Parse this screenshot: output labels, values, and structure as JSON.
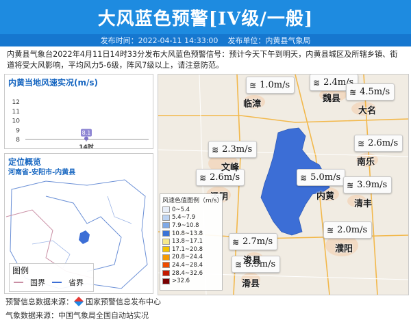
{
  "header": {
    "title": "大风蓝色预警[IV级/一般]",
    "publish_time": "发布时间：2022-04-11 14:33:00",
    "publish_unit": "发布单位：内黄县气象局"
  },
  "description": "内黄县气象台2022年4月11日14时33分发布大风蓝色预警信号：预计今天下午到明天，内黄县城区及所辖乡镇、街道将受大风影响，平均风力5-6级，阵风7级以上，请注意防范。",
  "wind_panel": {
    "title": "内黄当地风速实况(m/s)",
    "chart_data": {
      "type": "scatter",
      "categories": [
        "14时"
      ],
      "values": [
        8.1
      ],
      "ylim": [
        8,
        12
      ],
      "yticks": [
        "12",
        "11",
        "10",
        "9",
        "8"
      ],
      "value_label": "8.1"
    }
  },
  "location_panel": {
    "title": "定位概览",
    "path": "河南省-安阳市-内黄县",
    "legend_title": "图例",
    "legend_items": [
      "国界",
      "省界"
    ]
  },
  "map": {
    "badges": [
      {
        "value": "1.0m/s"
      },
      {
        "value": "2.4m/s"
      },
      {
        "value": "4.5m/s"
      },
      {
        "value": "2.6m/s"
      },
      {
        "value": "2.3m/s"
      },
      {
        "value": "2.6m/s"
      },
      {
        "value": "5.0m/s"
      },
      {
        "value": "3.9m/s"
      },
      {
        "value": "2.0m/s"
      },
      {
        "value": "2.7m/s"
      },
      {
        "value": "3.5m/s"
      }
    ],
    "cities": [
      "临漳",
      "魏县",
      "大名",
      "南乐",
      "文峰",
      "汤阴",
      "内黄",
      "清丰",
      "濮阳",
      "浚县",
      "滑县"
    ],
    "wind_legend": {
      "title": "风速色值图例（m/s）",
      "items": [
        {
          "label": "0~5.4",
          "color": "#e8eef8"
        },
        {
          "label": "5.4~7.9",
          "color": "#bcd3f2"
        },
        {
          "label": "7.9~10.8",
          "color": "#7fa9e6"
        },
        {
          "label": "10.8~13.8",
          "color": "#3a72d6"
        },
        {
          "label": "13.8~17.1",
          "color": "#f6e98a"
        },
        {
          "label": "17.1~20.8",
          "color": "#f5c400"
        },
        {
          "label": "20.8~24.4",
          "color": "#f59a00"
        },
        {
          "label": "24.4~28.4",
          "color": "#ee4b00"
        },
        {
          "label": "28.4~32.6",
          "color": "#c41a00"
        },
        {
          "label": ">32.6",
          "color": "#7a0000"
        }
      ]
    }
  },
  "footer": {
    "warning_source": "预警信息数据来源：",
    "warning_source_name": "国家预警信息发布中心",
    "weather_source": "气象数据来源：中国气象局全国自动站实况"
  },
  "colors": {
    "banner": "#1e8be0",
    "accent": "#1565c0",
    "region_fill": "#3c6ed6"
  }
}
